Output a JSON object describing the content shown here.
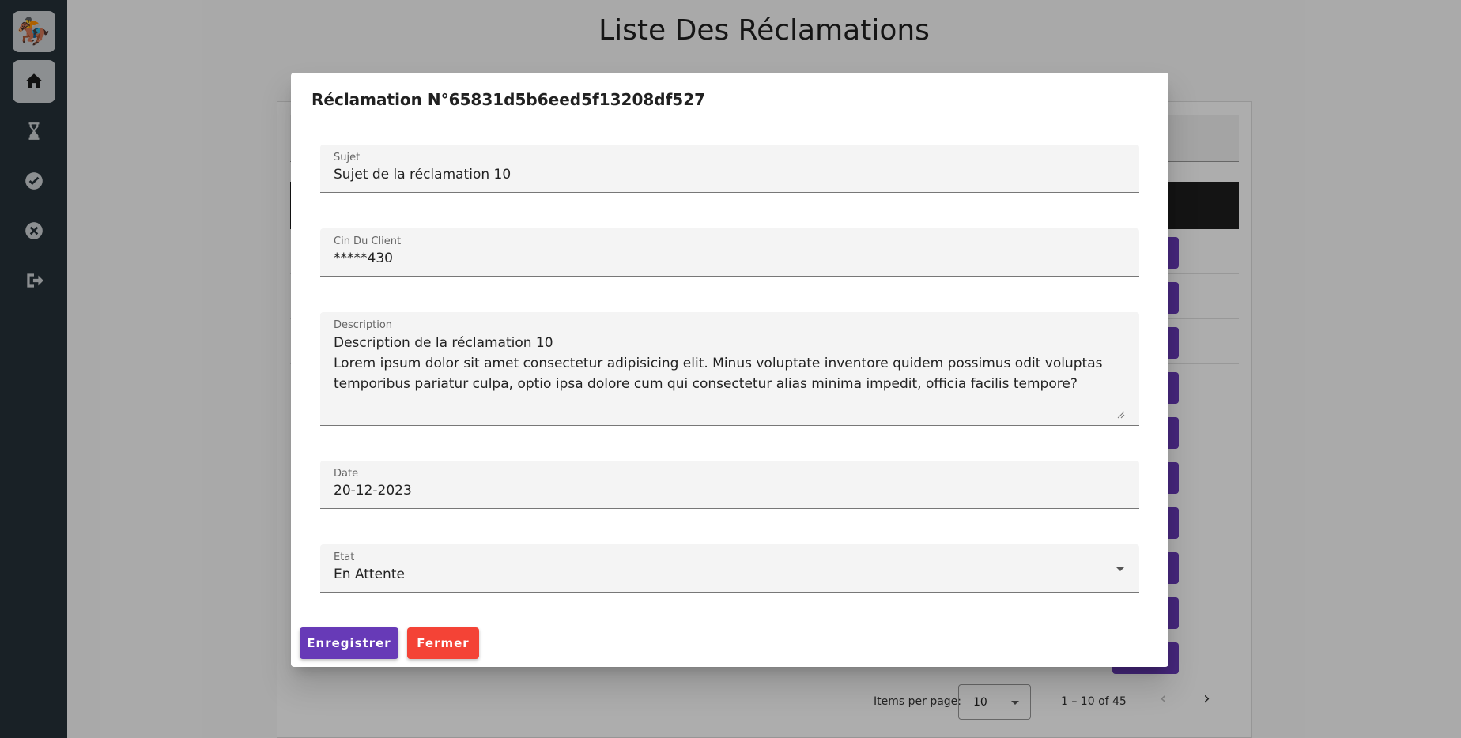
{
  "page": {
    "title": "Liste Des Réclamations"
  },
  "sidebar": {
    "items": [
      {
        "name": "home",
        "icon": "home-icon"
      },
      {
        "name": "pending",
        "icon": "hourglass-icon"
      },
      {
        "name": "resolved",
        "icon": "check-circle-icon"
      },
      {
        "name": "rejected",
        "icon": "x-circle-icon"
      },
      {
        "name": "logout",
        "icon": "logout-icon"
      }
    ],
    "accent": "#263238"
  },
  "paginator": {
    "items_per_page_label": "Items per page:",
    "items_per_page_value": "10",
    "range": "1 – 10 of 45",
    "prev": "‹",
    "next": "›"
  },
  "dialog": {
    "title": "Réclamation N°65831d5b6eed5f13208df527",
    "fields": {
      "subject": {
        "label": "Sujet",
        "value": "Sujet de la réclamation 10"
      },
      "cin": {
        "label": "Cin Du Client",
        "value": "*****430"
      },
      "description": {
        "label": "Description",
        "value": "Description de la réclamation 10\nLorem ipsum dolor sit amet consectetur adipisicing elit. Minus voluptate inventore quidem possimus odit voluptas temporibus pariatur culpa, optio ipsa dolore cum qui consectetur alias minima impedit, officia facilis tempore?"
      },
      "date": {
        "label": "Date",
        "value": "20-12-2023"
      },
      "status": {
        "label": "Etat",
        "value": "En Attente"
      }
    },
    "buttons": {
      "save": "Enregistrer",
      "close": "Fermer"
    },
    "colors": {
      "primary": "#673ab7",
      "warn": "#f44336"
    }
  }
}
